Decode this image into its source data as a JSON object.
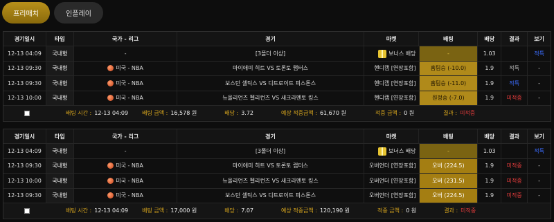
{
  "tabs": {
    "prematch": "프리매치",
    "inplay": "인플레이"
  },
  "headers": [
    "경기일시",
    "타입",
    "국가 - 리그",
    "경기",
    "마켓",
    "배팅",
    "배당",
    "결과",
    "보기"
  ],
  "slips": [
    {
      "rows": [
        {
          "time": "12-13 04:09",
          "type": "국내형",
          "league": "-",
          "game": "[3폴더 이상]",
          "market": "보너스 배당",
          "bet": "-",
          "odds": "1.03",
          "result": "",
          "view": "적특"
        },
        {
          "time": "12-13 09:30",
          "type": "국내형",
          "league": "미국 - NBA",
          "game": "마이애미 히트 VS 토론토 랩터스",
          "market": "핸디캡 [연장포함]",
          "bet": "홈팀승 (-10.0)",
          "odds": "1.9",
          "result": "적특",
          "view": "-"
        },
        {
          "time": "12-13 09:30",
          "type": "국내형",
          "league": "미국 - NBA",
          "game": "보스턴 셀틱스 VS 디트로이트 피스톤스",
          "market": "핸디캡 [연장포함]",
          "bet": "홈팀승 (-11.0)",
          "odds": "1.9",
          "result": "적특",
          "view": "-"
        },
        {
          "time": "12-13 10:00",
          "type": "국내형",
          "league": "미국 - NBA",
          "game": "뉴올리언즈 펠리컨즈 VS 새크라멘토 킹스",
          "market": "핸디캡 [연장포함]",
          "bet": "원정승 (-7.0)",
          "odds": "1.9",
          "result": "미적중",
          "view": "-"
        }
      ],
      "footer": {
        "bet_time_label": "배팅 시간 :",
        "bet_time": "12-13 04:09",
        "amount_label": "배팅 금액 :",
        "amount": "16,578 원",
        "odds_label": "배당 :",
        "odds": "3.72",
        "expected_label": "예상 적중금액 :",
        "expected": "61,670 원",
        "win_label": "적중 금액 :",
        "win": "0 원",
        "result_label": "결과 :",
        "result": "미적중"
      }
    },
    {
      "rows": [
        {
          "time": "12-13 04:09",
          "type": "국내형",
          "league": "-",
          "game": "[3폴더 이상]",
          "market": "보너스 배당",
          "bet": "-",
          "odds": "1.03",
          "result": "",
          "view": "적특"
        },
        {
          "time": "12-13 09:30",
          "type": "국내형",
          "league": "미국 - NBA",
          "game": "마이애미 히트 VS 토론토 랩터스",
          "market": "오버언더 [연장포함]",
          "bet": "오버 (224.5)",
          "odds": "1.9",
          "result": "미적중",
          "view": "-"
        },
        {
          "time": "12-13 10:00",
          "type": "국내형",
          "league": "미국 - NBA",
          "game": "뉴올리언즈 펠리컨즈 VS 새크라멘토 킹스",
          "market": "오버언더 [연장포함]",
          "bet": "오버 (231.5)",
          "odds": "1.9",
          "result": "미적중",
          "view": "-"
        },
        {
          "time": "12-13 09:30",
          "type": "국내형",
          "league": "미국 - NBA",
          "game": "보스턴 셀틱스 VS 디트로이트 피스톤스",
          "market": "오버언더 [연장포함]",
          "bet": "오버 (224.5)",
          "odds": "1.9",
          "result": "미적중",
          "view": "-"
        }
      ],
      "footer": {
        "bet_time_label": "배팅 시간 :",
        "bet_time": "12-13 04:09",
        "amount_label": "배팅 금액 :",
        "amount": "17,000 원",
        "odds_label": "배당 :",
        "odds": "7.07",
        "expected_label": "예상 적중금액 :",
        "expected": "120,190 원",
        "win_label": "적중 금액 :",
        "win": "0 원",
        "result_label": "결과 :",
        "result": "미적중"
      }
    }
  ]
}
